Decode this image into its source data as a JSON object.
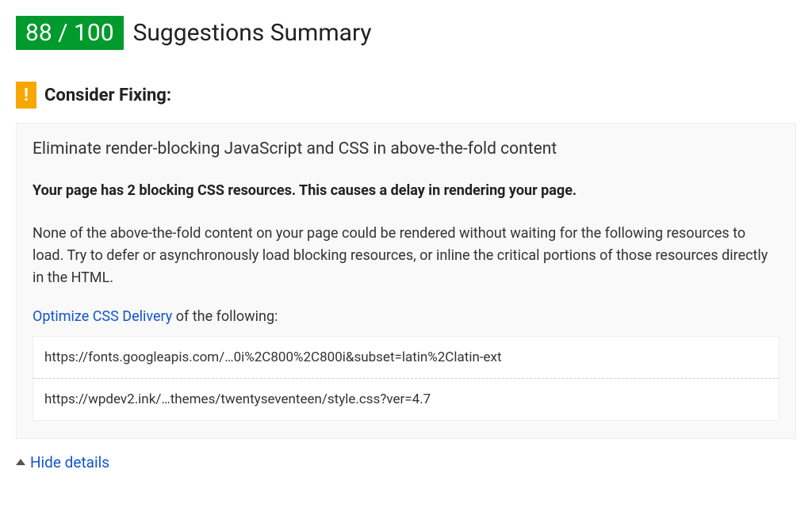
{
  "header": {
    "score": "88 / 100",
    "title": "Suggestions Summary"
  },
  "section": {
    "warn_glyph": "!",
    "heading": "Consider Fixing:",
    "rule_title": "Eliminate render-blocking JavaScript and CSS in above-the-fold content",
    "impact": "Your page has 2 blocking CSS resources. This causes a delay in rendering your page.",
    "explanation": "None of the above-the-fold content on your page could be rendered without waiting for the following resources to load. Try to defer or asynchronously load blocking resources, or inline the critical portions of those resources directly in the HTML.",
    "optimize_link": "Optimize CSS Delivery",
    "optimize_suffix": " of the following:",
    "urls": [
      "https://fonts.googleapis.com/…0i%2C800%2C800i&subset=latin%2Clatin-ext",
      "https://wpdev2.ink/…themes/twentyseventeen/style.css?ver=4.7"
    ],
    "hide_label": "Hide details"
  }
}
